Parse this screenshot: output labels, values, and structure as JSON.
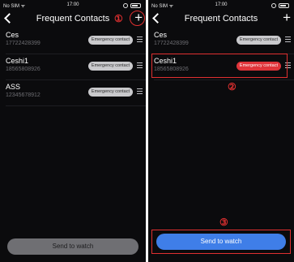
{
  "left_screen": {
    "status": {
      "carrier": "No SIM ᯤ",
      "time": "17:00"
    },
    "title": "Frequent Contacts",
    "add_label": "+",
    "step_marker": "①",
    "contacts": [
      {
        "name": "Ces",
        "phone": "17722428399",
        "badge": "Emergency contact"
      },
      {
        "name": "Ceshi1",
        "phone": "18565808926",
        "badge": "Emergency contact"
      },
      {
        "name": "ASS",
        "phone": "12345678912",
        "badge": "Emergency contact"
      }
    ],
    "send_label": "Send to watch"
  },
  "right_screen": {
    "status": {
      "carrier": "No SIM ᯤ",
      "time": "17:00"
    },
    "title": "Frequent Contacts",
    "add_label": "+",
    "contacts": [
      {
        "name": "Ces",
        "phone": "17722428399",
        "badge": "Emergency contact"
      },
      {
        "name": "Ceshi1",
        "phone": "18565808926",
        "badge": "Emergency contact"
      }
    ],
    "step_marker_2": "②",
    "step_marker_3": "③",
    "send_label": "Send to watch"
  },
  "colors": {
    "annotation": "#e03030",
    "emergency_active": "#e0343a",
    "send_active": "#3f7ee8",
    "send_disabled": "#6f6f73"
  }
}
